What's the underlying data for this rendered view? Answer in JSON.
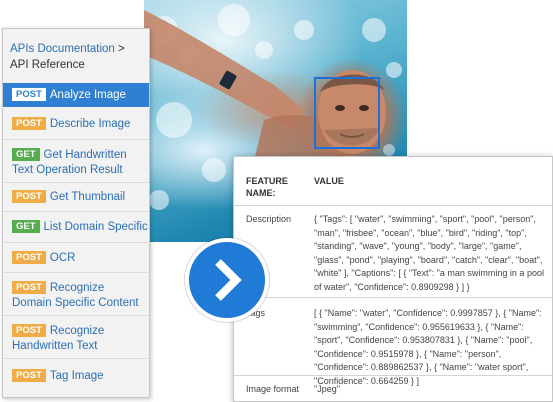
{
  "breadcrumb": {
    "link": "APIs Documentation",
    "separator": " > ",
    "current": "API Reference"
  },
  "api_items": [
    {
      "method": "POST",
      "label": "Analyze Image",
      "active": true
    },
    {
      "method": "POST",
      "label": "Describe Image"
    },
    {
      "method": "GET",
      "label": "Get Handwritten Text Operation Result"
    },
    {
      "method": "POST",
      "label": "Get Thumbnail"
    },
    {
      "method": "GET",
      "label": "List Domain Specific Mo"
    },
    {
      "method": "POST",
      "label": "OCR"
    },
    {
      "method": "POST",
      "label": "Recognize Domain Specific Content"
    },
    {
      "method": "POST",
      "label": "Recognize Handwritten Text"
    },
    {
      "method": "POST",
      "label": "Tag Image"
    }
  ],
  "table": {
    "header_feature": "FEATURE NAME:",
    "header_value": "VALUE",
    "rows": [
      {
        "feature": "Description",
        "value": "{ \"Tags\": [ \"water\", \"swimming\", \"sport\", \"pool\", \"person\", \"man\", \"frisbee\", \"ocean\", \"blue\", \"bird\", \"riding\", \"top\", \"standing\", \"wave\", \"young\", \"body\", \"large\", \"game\", \"glass\", \"pond\", \"playing\", \"board\", \"catch\", \"clear\", \"boat\", \"white\" ], \"Captions\": [ { \"Text\": \"a man swimming in a pool of water\", \"Confidence\": 0.8909298 } ] }"
      },
      {
        "feature": "Tags",
        "value": "[ { \"Name\": \"water\", \"Confidence\": 0.9997857 }, { \"Name\": \"swimming\", \"Confidence\": 0.955619633 }, { \"Name\": \"sport\", \"Confidence\": 0.953807831 }, { \"Name\": \"pool\", \"Confidence\": 0.9515978 }, { \"Name\": \"person\", \"Confidence\": 0.889862537 }, { \"Name\": \"water sport\", \"Confidence\": 0.664259 } ]"
      },
      {
        "feature": "Image format",
        "value": "\"Jpeg\""
      }
    ]
  },
  "colors": {
    "accent": "#2f80d2",
    "post_badge": "#f0ac47",
    "get_badge": "#56ad4d",
    "link": "#2b6fb6",
    "face_box": "#1e6fd8"
  },
  "icons": {
    "arrow": "chevron-right-icon"
  }
}
